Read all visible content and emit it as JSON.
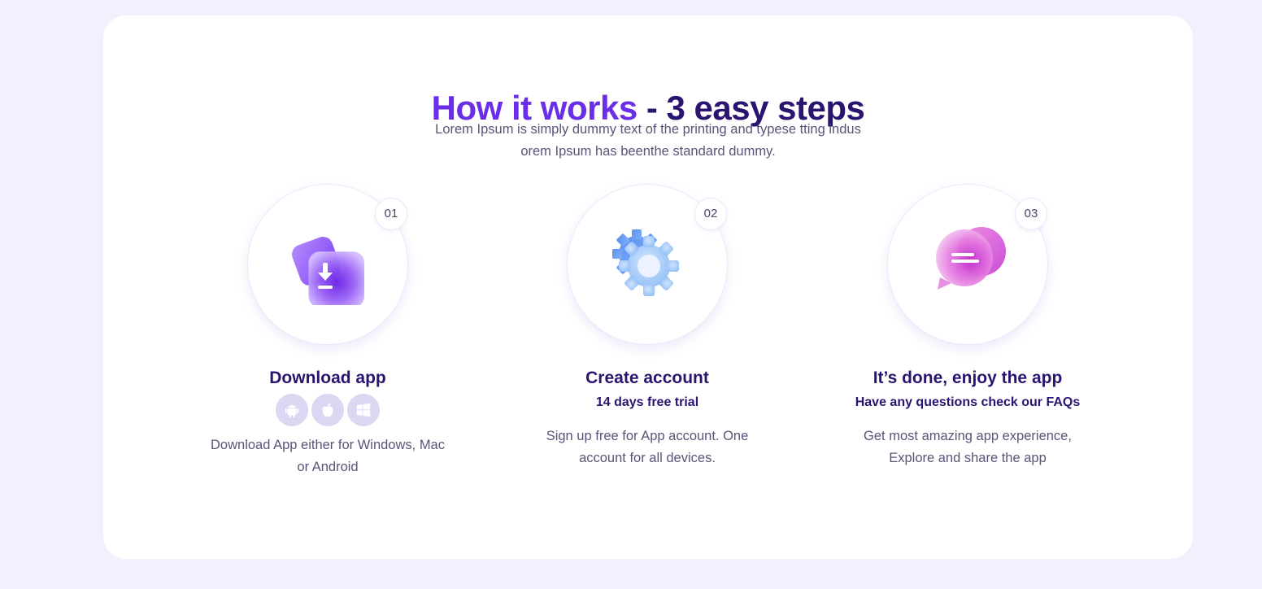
{
  "section": {
    "title_accent": "How it works",
    "title_rest": " - 3 easy steps",
    "subtitle": "Lorem Ipsum is simply dummy text of the printing and typese tting indus orem Ipsum has beenthe standard dummy."
  },
  "steps": [
    {
      "number": "01",
      "icon": "download-icon",
      "title": "Download app",
      "platforms": [
        "android-icon",
        "apple-icon",
        "windows-icon"
      ],
      "description": "Download App either for Windows, Mac or Android"
    },
    {
      "number": "02",
      "icon": "gear-icon",
      "title": "Create account",
      "subtitle": "14 days free trial",
      "description": "Sign up free for App account. One account for all devices."
    },
    {
      "number": "03",
      "icon": "chat-icon",
      "title": "It’s done, enjoy the app",
      "subtitle": "Have any questions check our FAQs",
      "description": "Get most amazing app experience, Explore and share the app"
    }
  ],
  "colors": {
    "accent": "#6a2ee8",
    "heading": "#2a1470",
    "body_text": "#5a5478",
    "background": "#f3f0fd"
  }
}
